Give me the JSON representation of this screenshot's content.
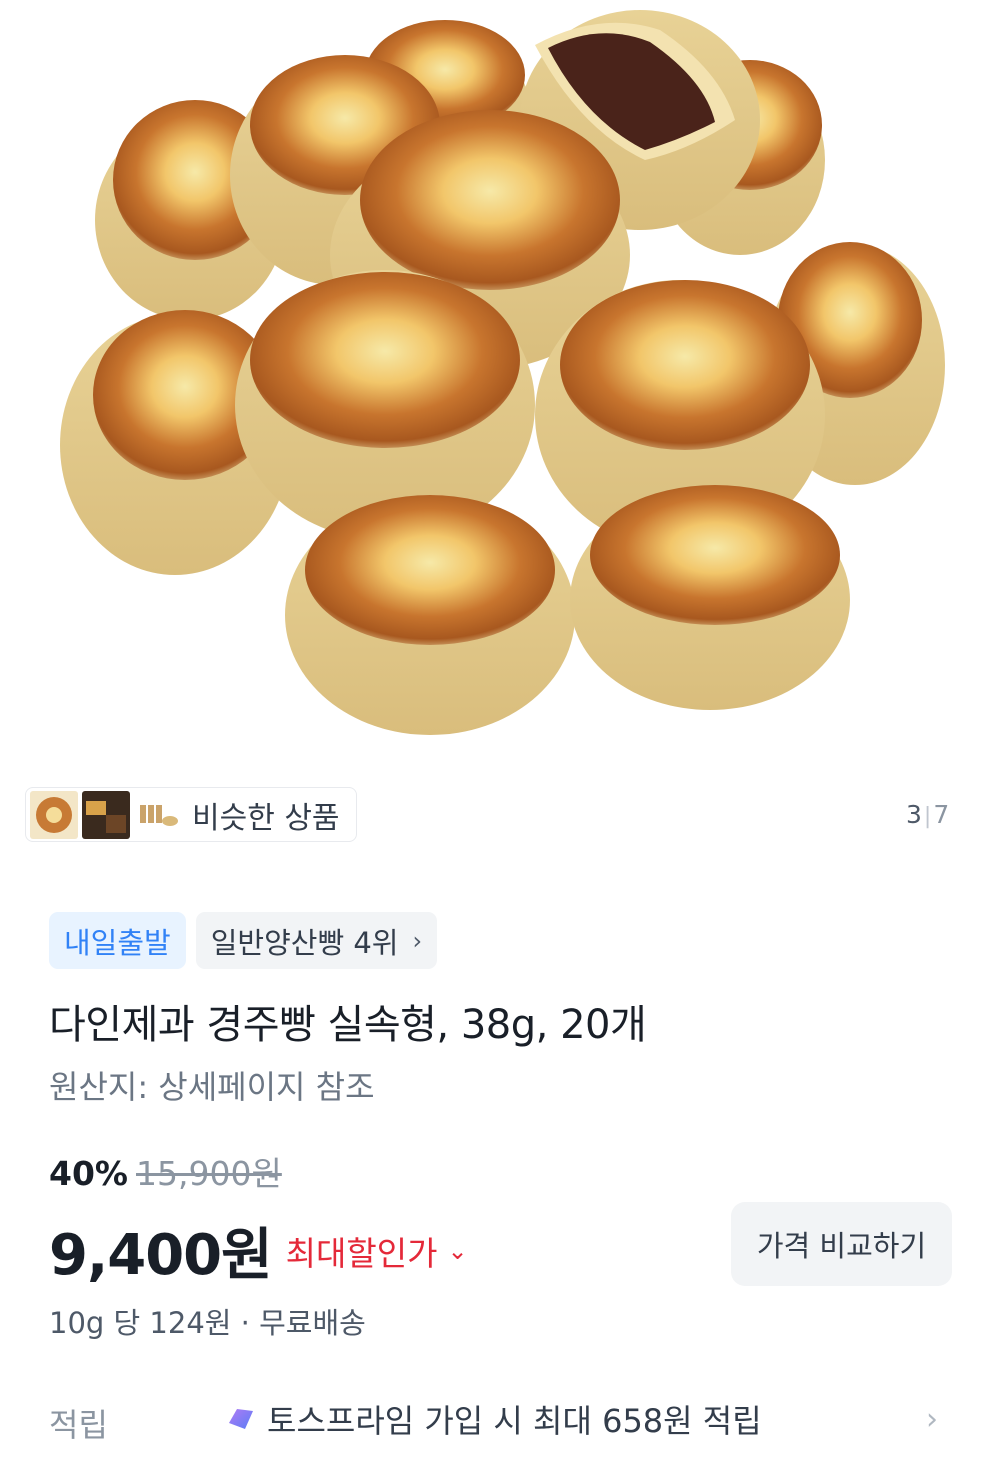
{
  "hero": {
    "image": "bread-product-photo"
  },
  "similar": {
    "label": "비슷한 상품"
  },
  "gallery": {
    "current": "3",
    "separator": "|",
    "total": "7"
  },
  "badges": {
    "delivery": "내일출발",
    "ranking": "일반양산빵 4위"
  },
  "product": {
    "title": "다인제과 경주빵 실속형, 38g, 20개",
    "origin": "원산지: 상세페이지 참조"
  },
  "pricing": {
    "discount_rate": "40%",
    "original_price": "15,900원",
    "price": "9,400원",
    "max_discount_label": "최대할인가",
    "compare_button": "가격 비교하기",
    "unit_price": "10g 당 124원 · 무료배송"
  },
  "points": {
    "label": "적립",
    "text": "토스프라임 가입 시 최대 658원 적립"
  },
  "colors": {
    "accent_blue": "#3182f6",
    "discount_red": "#e42939"
  }
}
